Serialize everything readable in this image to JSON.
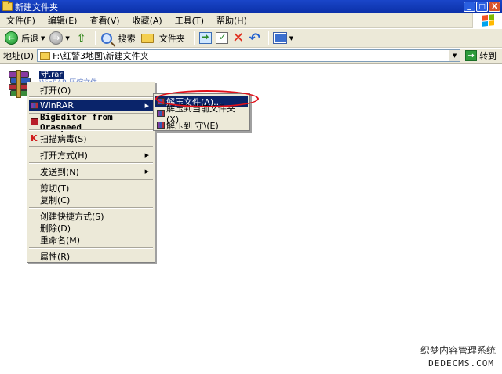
{
  "window": {
    "title": "新建文件夹",
    "min": "_",
    "max": "□",
    "close": "X"
  },
  "menubar": [
    "文件(F)",
    "编辑(E)",
    "查看(V)",
    "收藏(A)",
    "工具(T)",
    "帮助(H)"
  ],
  "toolbar": {
    "back": "后退",
    "search": "搜索",
    "folders": "文件夹"
  },
  "address": {
    "label": "地址(D)",
    "path": "F:\\红警3地图\\新建文件夹",
    "go": "转到"
  },
  "file": {
    "name": "守.rar",
    "subtitle": "WinRAR 压缩文件"
  },
  "context_menu": {
    "open": "打开(O)",
    "winrar": "WinRAR",
    "bigeditor": "BigEditor from Oraspeed",
    "scan": "扫描病毒(S)",
    "open_with": "打开方式(H)",
    "send_to": "发送到(N)",
    "cut": "剪切(T)",
    "copy": "复制(C)",
    "shortcut": "创建快捷方式(S)",
    "delete": "删除(D)",
    "rename": "重命名(M)",
    "properties": "属性(R)"
  },
  "submenu": {
    "extract_files": "解压文件(A)...",
    "extract_here": "解压到当前文件夹(X)",
    "extract_to": "解压到 守\\(E)"
  },
  "watermark": {
    "line1": "织梦内容管理系统",
    "line2": "DEDECMS.COM"
  },
  "colors": {
    "title_blue": "#0b30a8",
    "highlight": "#0a246a",
    "menu_bg": "#ece9d8",
    "annotation": "#e0101a"
  }
}
